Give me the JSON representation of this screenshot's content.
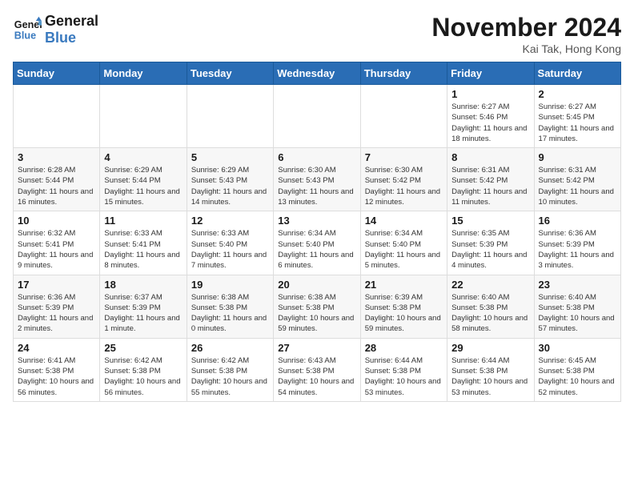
{
  "logo": {
    "line1": "General",
    "line2": "Blue"
  },
  "title": "November 2024",
  "location": "Kai Tak, Hong Kong",
  "days_header": [
    "Sunday",
    "Monday",
    "Tuesday",
    "Wednesday",
    "Thursday",
    "Friday",
    "Saturday"
  ],
  "weeks": [
    [
      {
        "day": "",
        "info": ""
      },
      {
        "day": "",
        "info": ""
      },
      {
        "day": "",
        "info": ""
      },
      {
        "day": "",
        "info": ""
      },
      {
        "day": "",
        "info": ""
      },
      {
        "day": "1",
        "info": "Sunrise: 6:27 AM\nSunset: 5:46 PM\nDaylight: 11 hours and 18 minutes."
      },
      {
        "day": "2",
        "info": "Sunrise: 6:27 AM\nSunset: 5:45 PM\nDaylight: 11 hours and 17 minutes."
      }
    ],
    [
      {
        "day": "3",
        "info": "Sunrise: 6:28 AM\nSunset: 5:44 PM\nDaylight: 11 hours and 16 minutes."
      },
      {
        "day": "4",
        "info": "Sunrise: 6:29 AM\nSunset: 5:44 PM\nDaylight: 11 hours and 15 minutes."
      },
      {
        "day": "5",
        "info": "Sunrise: 6:29 AM\nSunset: 5:43 PM\nDaylight: 11 hours and 14 minutes."
      },
      {
        "day": "6",
        "info": "Sunrise: 6:30 AM\nSunset: 5:43 PM\nDaylight: 11 hours and 13 minutes."
      },
      {
        "day": "7",
        "info": "Sunrise: 6:30 AM\nSunset: 5:42 PM\nDaylight: 11 hours and 12 minutes."
      },
      {
        "day": "8",
        "info": "Sunrise: 6:31 AM\nSunset: 5:42 PM\nDaylight: 11 hours and 11 minutes."
      },
      {
        "day": "9",
        "info": "Sunrise: 6:31 AM\nSunset: 5:42 PM\nDaylight: 11 hours and 10 minutes."
      }
    ],
    [
      {
        "day": "10",
        "info": "Sunrise: 6:32 AM\nSunset: 5:41 PM\nDaylight: 11 hours and 9 minutes."
      },
      {
        "day": "11",
        "info": "Sunrise: 6:33 AM\nSunset: 5:41 PM\nDaylight: 11 hours and 8 minutes."
      },
      {
        "day": "12",
        "info": "Sunrise: 6:33 AM\nSunset: 5:40 PM\nDaylight: 11 hours and 7 minutes."
      },
      {
        "day": "13",
        "info": "Sunrise: 6:34 AM\nSunset: 5:40 PM\nDaylight: 11 hours and 6 minutes."
      },
      {
        "day": "14",
        "info": "Sunrise: 6:34 AM\nSunset: 5:40 PM\nDaylight: 11 hours and 5 minutes."
      },
      {
        "day": "15",
        "info": "Sunrise: 6:35 AM\nSunset: 5:39 PM\nDaylight: 11 hours and 4 minutes."
      },
      {
        "day": "16",
        "info": "Sunrise: 6:36 AM\nSunset: 5:39 PM\nDaylight: 11 hours and 3 minutes."
      }
    ],
    [
      {
        "day": "17",
        "info": "Sunrise: 6:36 AM\nSunset: 5:39 PM\nDaylight: 11 hours and 2 minutes."
      },
      {
        "day": "18",
        "info": "Sunrise: 6:37 AM\nSunset: 5:39 PM\nDaylight: 11 hours and 1 minute."
      },
      {
        "day": "19",
        "info": "Sunrise: 6:38 AM\nSunset: 5:38 PM\nDaylight: 11 hours and 0 minutes."
      },
      {
        "day": "20",
        "info": "Sunrise: 6:38 AM\nSunset: 5:38 PM\nDaylight: 10 hours and 59 minutes."
      },
      {
        "day": "21",
        "info": "Sunrise: 6:39 AM\nSunset: 5:38 PM\nDaylight: 10 hours and 59 minutes."
      },
      {
        "day": "22",
        "info": "Sunrise: 6:40 AM\nSunset: 5:38 PM\nDaylight: 10 hours and 58 minutes."
      },
      {
        "day": "23",
        "info": "Sunrise: 6:40 AM\nSunset: 5:38 PM\nDaylight: 10 hours and 57 minutes."
      }
    ],
    [
      {
        "day": "24",
        "info": "Sunrise: 6:41 AM\nSunset: 5:38 PM\nDaylight: 10 hours and 56 minutes."
      },
      {
        "day": "25",
        "info": "Sunrise: 6:42 AM\nSunset: 5:38 PM\nDaylight: 10 hours and 56 minutes."
      },
      {
        "day": "26",
        "info": "Sunrise: 6:42 AM\nSunset: 5:38 PM\nDaylight: 10 hours and 55 minutes."
      },
      {
        "day": "27",
        "info": "Sunrise: 6:43 AM\nSunset: 5:38 PM\nDaylight: 10 hours and 54 minutes."
      },
      {
        "day": "28",
        "info": "Sunrise: 6:44 AM\nSunset: 5:38 PM\nDaylight: 10 hours and 53 minutes."
      },
      {
        "day": "29",
        "info": "Sunrise: 6:44 AM\nSunset: 5:38 PM\nDaylight: 10 hours and 53 minutes."
      },
      {
        "day": "30",
        "info": "Sunrise: 6:45 AM\nSunset: 5:38 PM\nDaylight: 10 hours and 52 minutes."
      }
    ]
  ]
}
